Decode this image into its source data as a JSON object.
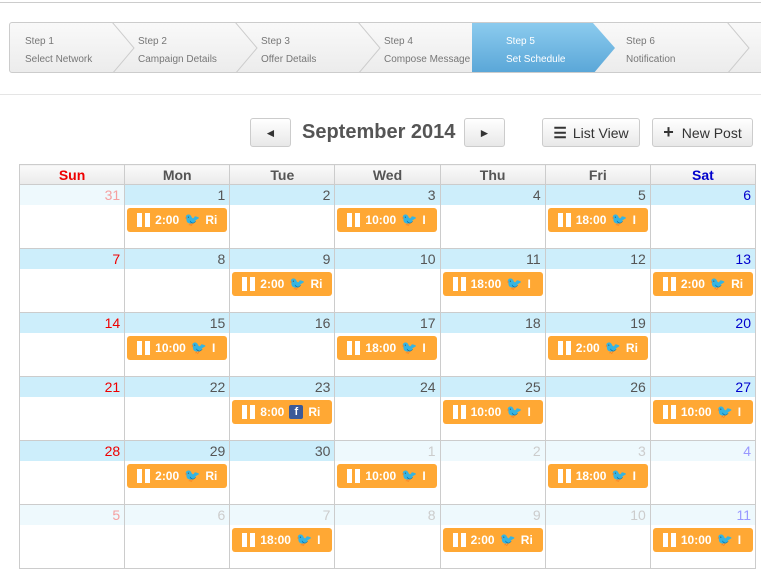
{
  "wizard": {
    "steps": [
      {
        "num": "Step 1",
        "label": "Select Network"
      },
      {
        "num": "Step 2",
        "label": "Campaign Details"
      },
      {
        "num": "Step 3",
        "label": "Offer Details"
      },
      {
        "num": "Step 4",
        "label": "Compose Message"
      },
      {
        "num": "Step 5",
        "label": "Set Schedule",
        "active": true
      },
      {
        "num": "Step 6",
        "label": "Notification"
      }
    ]
  },
  "calendar": {
    "title": "September 2014",
    "prev": "◄",
    "next": "►",
    "list_view": "List View",
    "new_post": "New Post",
    "days": [
      "Sun",
      "Mon",
      "Tue",
      "Wed",
      "Thu",
      "Fri",
      "Sat"
    ],
    "colors": {
      "event": "#ffa834",
      "day_band": "#cdeefb",
      "sun": "#e00000",
      "sat": "#0000cc"
    },
    "weeks": [
      [
        {
          "day": "31",
          "other": true
        },
        {
          "day": "1",
          "event": {
            "time": "2:00",
            "network": "twitter",
            "text": "Ri"
          }
        },
        {
          "day": "2"
        },
        {
          "day": "3",
          "event": {
            "time": "10:00",
            "network": "twitter",
            "text": "I"
          }
        },
        {
          "day": "4"
        },
        {
          "day": "5",
          "event": {
            "time": "18:00",
            "network": "twitter",
            "text": "I"
          }
        },
        {
          "day": "6"
        }
      ],
      [
        {
          "day": "7"
        },
        {
          "day": "8"
        },
        {
          "day": "9",
          "event": {
            "time": "2:00",
            "network": "twitter",
            "text": "Ri"
          }
        },
        {
          "day": "10"
        },
        {
          "day": "11",
          "event": {
            "time": "18:00",
            "network": "twitter",
            "text": "I"
          }
        },
        {
          "day": "12"
        },
        {
          "day": "13",
          "event": {
            "time": "2:00",
            "network": "twitter",
            "text": "Ri"
          }
        }
      ],
      [
        {
          "day": "14"
        },
        {
          "day": "15",
          "event": {
            "time": "10:00",
            "network": "twitter",
            "text": "I"
          }
        },
        {
          "day": "16"
        },
        {
          "day": "17",
          "event": {
            "time": "18:00",
            "network": "twitter",
            "text": "I"
          }
        },
        {
          "day": "18"
        },
        {
          "day": "19",
          "event": {
            "time": "2:00",
            "network": "twitter",
            "text": "Ri"
          }
        },
        {
          "day": "20"
        }
      ],
      [
        {
          "day": "21"
        },
        {
          "day": "22"
        },
        {
          "day": "23",
          "event": {
            "time": "8:00",
            "network": "facebook",
            "text": "Ri"
          }
        },
        {
          "day": "24"
        },
        {
          "day": "25",
          "event": {
            "time": "10:00",
            "network": "twitter",
            "text": "I"
          }
        },
        {
          "day": "26"
        },
        {
          "day": "27",
          "event": {
            "time": "10:00",
            "network": "twitter",
            "text": "I"
          }
        }
      ],
      [
        {
          "day": "28"
        },
        {
          "day": "29",
          "event": {
            "time": "2:00",
            "network": "twitter",
            "text": "Ri"
          }
        },
        {
          "day": "30"
        },
        {
          "day": "1",
          "other": true,
          "event": {
            "time": "10:00",
            "network": "twitter",
            "text": "I"
          }
        },
        {
          "day": "2",
          "other": true
        },
        {
          "day": "3",
          "other": true,
          "event": {
            "time": "18:00",
            "network": "twitter",
            "text": "I"
          }
        },
        {
          "day": "4",
          "other": true
        }
      ],
      [
        {
          "day": "5",
          "other": true
        },
        {
          "day": "6",
          "other": true
        },
        {
          "day": "7",
          "other": true,
          "event": {
            "time": "18:00",
            "network": "twitter",
            "text": "I"
          }
        },
        {
          "day": "8",
          "other": true
        },
        {
          "day": "9",
          "other": true,
          "event": {
            "time": "2:00",
            "network": "twitter",
            "text": "Ri"
          }
        },
        {
          "day": "10",
          "other": true
        },
        {
          "day": "11",
          "other": true,
          "event": {
            "time": "10:00",
            "network": "twitter",
            "text": "I"
          }
        }
      ]
    ]
  }
}
